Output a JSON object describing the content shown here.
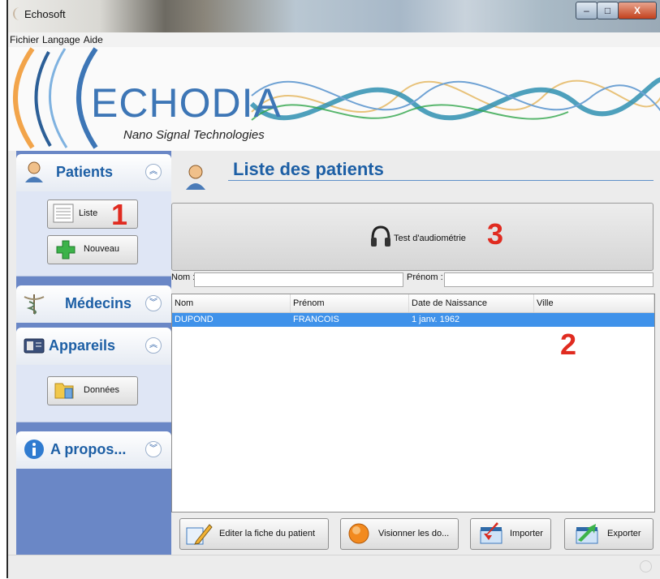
{
  "window": {
    "title": "Echosoft",
    "controls": {
      "minimize": "–",
      "maximize": "□",
      "close": "X"
    }
  },
  "menu": [
    "Fichier",
    "Langage",
    "Aide"
  ],
  "banner": {
    "brand": "ECHODIA",
    "tagline": "Nano Signal Technologies"
  },
  "sidebar": {
    "patients": {
      "title": "Patients",
      "chevron": "up",
      "buttons": {
        "list": "Liste",
        "new": "Nouveau"
      }
    },
    "medecins": {
      "title": "Médecins",
      "chevron": "down"
    },
    "appareils": {
      "title": "Appareils",
      "chevron": "up",
      "buttons": {
        "data": "Données"
      }
    },
    "apropos": {
      "title": "A propos...",
      "chevron": "down"
    }
  },
  "main": {
    "title": "Liste des patients",
    "test_button": "Test d'audiométrie",
    "filters": {
      "nom_label": "Nom :",
      "nom_value": "",
      "prenom_label": "Prénom :",
      "prenom_value": ""
    },
    "table": {
      "columns": [
        "Nom",
        "Prénom",
        "Date de Naissance",
        "Ville"
      ],
      "rows": [
        {
          "nom": "DUPOND",
          "prenom": "FRANCOIS",
          "naissance": "1 janv. 1962",
          "ville": ""
        }
      ]
    },
    "buttons": {
      "edit": "Editer la fiche du patient",
      "view": "Visionner les do...",
      "import": "Importer",
      "export": "Exporter"
    }
  },
  "annotations": [
    "1",
    "2",
    "3"
  ],
  "colors": {
    "accent": "#1d5fa5",
    "sidebar_bg": "#6a87c6",
    "selection": "#3f92ea",
    "annotation": "#e02b20"
  }
}
